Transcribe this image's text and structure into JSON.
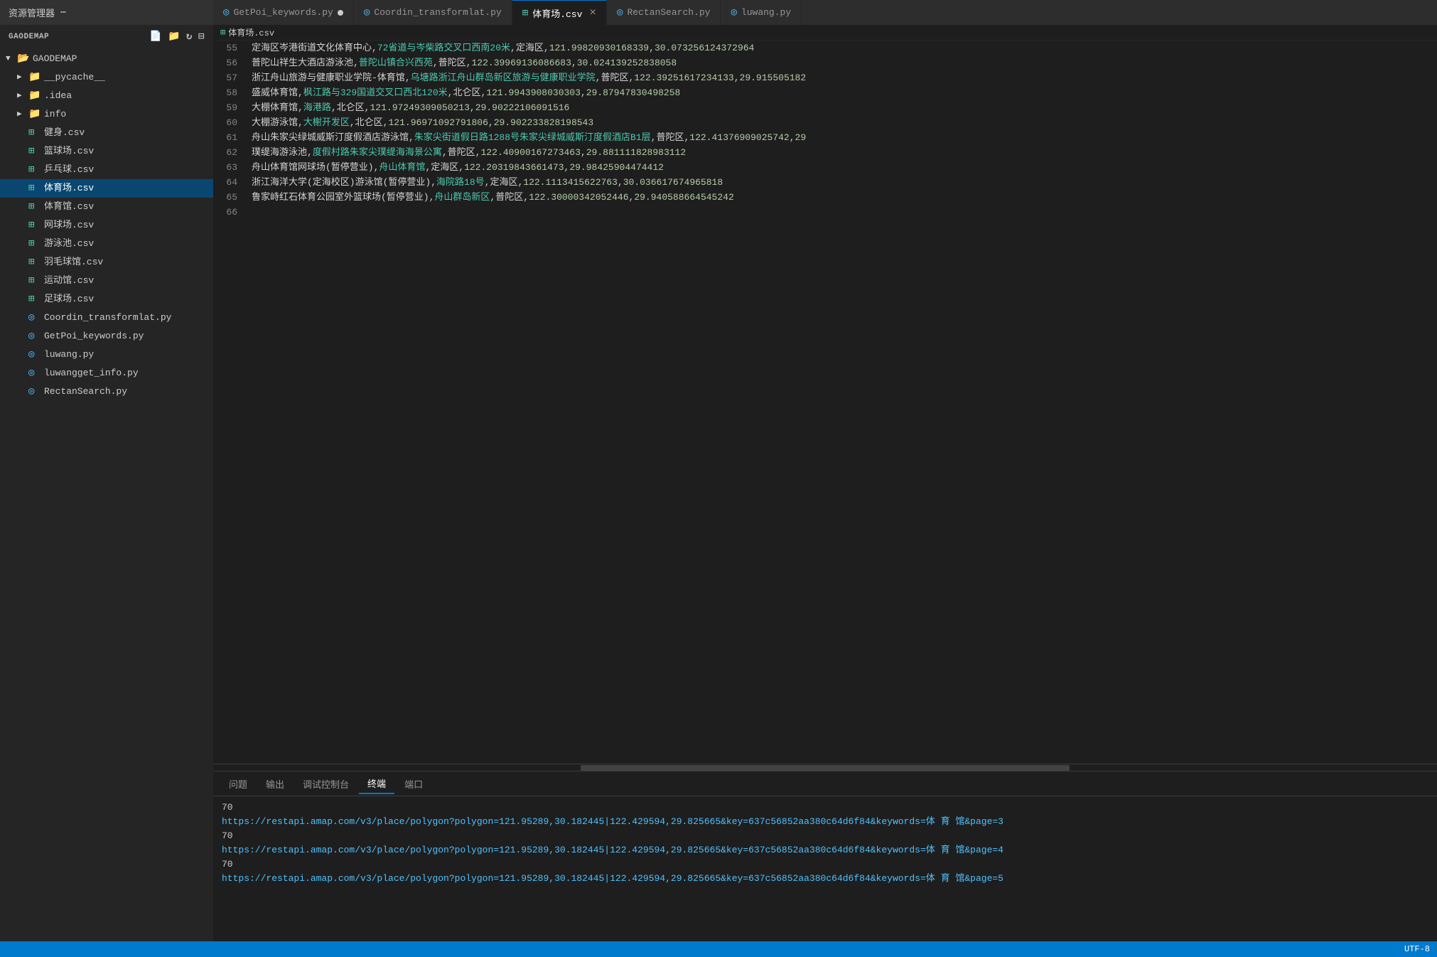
{
  "titlebar": {
    "explorer_label": "资源管理器",
    "more_icon": "⋯"
  },
  "tabs": [
    {
      "id": "tab-getpoi",
      "label": "GetPoi_keywords.py",
      "type": "py",
      "active": false,
      "modified": true,
      "close": false
    },
    {
      "id": "tab-coordin",
      "label": "Coordin_transformlat.py",
      "type": "py",
      "active": false,
      "modified": false,
      "close": false
    },
    {
      "id": "tab-tiyuchang",
      "label": "体育场.csv",
      "type": "csv",
      "active": true,
      "modified": false,
      "close": true
    },
    {
      "id": "tab-rectansearch",
      "label": "RectanSearch.py",
      "type": "py",
      "active": false,
      "modified": false,
      "close": false
    },
    {
      "id": "tab-luwang",
      "label": "luwang.py",
      "type": "py",
      "active": false,
      "modified": false,
      "close": false
    }
  ],
  "sidebar": {
    "title": "资源管理器",
    "root_label": "GAODEMAP",
    "items": [
      {
        "id": "pycache",
        "label": "__pycache__",
        "type": "folder",
        "indent": 1,
        "arrow": "▶"
      },
      {
        "id": "idea",
        "label": ".idea",
        "type": "folder",
        "indent": 1,
        "arrow": "▶"
      },
      {
        "id": "info",
        "label": "info",
        "type": "folder",
        "indent": 1,
        "arrow": "▶"
      },
      {
        "id": "jiansheng",
        "label": "健身.csv",
        "type": "csv",
        "indent": 1
      },
      {
        "id": "lanqiu",
        "label": "篮球场.csv",
        "type": "csv",
        "indent": 1
      },
      {
        "id": "pingpang",
        "label": "乒乓球.csv",
        "type": "csv",
        "indent": 1
      },
      {
        "id": "tiyuchang",
        "label": "体育场.csv",
        "type": "csv",
        "indent": 1,
        "selected": true
      },
      {
        "id": "tiyuguan",
        "label": "体育馆.csv",
        "type": "csv",
        "indent": 1
      },
      {
        "id": "wangqiu",
        "label": "网球场.csv",
        "type": "csv",
        "indent": 1
      },
      {
        "id": "youyongchi",
        "label": "游泳池.csv",
        "type": "csv",
        "indent": 1
      },
      {
        "id": "yumao",
        "label": "羽毛球馆.csv",
        "type": "csv",
        "indent": 1
      },
      {
        "id": "yundongguan",
        "label": "运动馆.csv",
        "type": "csv",
        "indent": 1
      },
      {
        "id": "zuqiu",
        "label": "足球场.csv",
        "type": "csv",
        "indent": 1
      },
      {
        "id": "coordin_py",
        "label": "Coordin_transformlat.py",
        "type": "py",
        "indent": 1
      },
      {
        "id": "getpoi_py",
        "label": "GetPoi_keywords.py",
        "type": "py",
        "indent": 1
      },
      {
        "id": "luwang_py",
        "label": "luwang.py",
        "type": "py",
        "indent": 1
      },
      {
        "id": "luwangget_py",
        "label": "luwangget_info.py",
        "type": "py",
        "indent": 1
      },
      {
        "id": "rectansearch_py",
        "label": "RectanSearch.py",
        "type": "py",
        "indent": 1
      }
    ]
  },
  "breadcrumb": {
    "icon": "⊞",
    "label": "体育场.csv"
  },
  "code_lines": [
    {
      "num": "55",
      "text": "定海区岑港街道文化体育中心,72省道与岑柴路交叉口西南20米,定海区,121.99820930168339,30.073256124372964"
    },
    {
      "num": "56",
      "text": "普陀山祥生大酒店游泳池,普陀山镇合兴西苑,普陀区,122.39969136086683,30.024139252838058"
    },
    {
      "num": "57",
      "text": "浙江舟山旅游与健康职业学院-体育馆,乌塘路浙江舟山群岛新区旅游与健康职业学院,普陀区,122.39251617234133,29.915505182"
    },
    {
      "num": "58",
      "text": "盛威体育馆,枫江路与329国道交叉口西北120米,北仑区,121.9943908030303,29.87947830498258"
    },
    {
      "num": "59",
      "text": "大棚体育馆,海港路,北仑区,121.97249309050213,29.90222106091516"
    },
    {
      "num": "60",
      "text": "大棚游泳馆,大榭开发区,北仑区,121.96971092791806,29.902233828198543"
    },
    {
      "num": "61",
      "text": "舟山朱家尖绿城威斯汀度假酒店游泳馆,朱家尖街道假日路1288号朱家尖绿城威斯汀度假酒店B1层,普陀区,122.41376909025742,29"
    },
    {
      "num": "62",
      "text": "璞缇海游泳池,度假村路朱家尖璞缇海海景公寓,普陀区,122.40900167273463,29.881111828983112"
    },
    {
      "num": "63",
      "text": "舟山体育馆网球场(暂停营业),舟山体育馆,定海区,122.20319843661473,29.98425904474412"
    },
    {
      "num": "64",
      "text": "浙江海洋大学(定海校区)游泳馆(暂停营业),海院路18号,定海区,122.1113415622763,30.036617674965818"
    },
    {
      "num": "65",
      "text": "鲁家峙红石体育公园室外篮球场(暂停营业),舟山群岛新区,普陀区,122.30000342052446,29.940588664545242"
    },
    {
      "num": "66",
      "text": ""
    }
  ],
  "terminal": {
    "tabs": [
      {
        "id": "problems",
        "label": "问题"
      },
      {
        "id": "output",
        "label": "输出"
      },
      {
        "id": "debug",
        "label": "调试控制台"
      },
      {
        "id": "terminal",
        "label": "终端",
        "active": true
      },
      {
        "id": "port",
        "label": "端口"
      }
    ],
    "lines": [
      "70",
      "https://restapi.amap.com/v3/place/polygon?polygon=121.95289,30.182445|122.429594,29.825665&key=637c56852aa380c64d6f84&keywords=体 育 馆&page=3",
      "70",
      "https://restapi.amap.com/v3/place/polygon?polygon=121.95289,30.182445|122.429594,29.825665&key=637c56852aa380c64d6f84&keywords=体 育 馆&page=4",
      "70",
      "https://restapi.amap.com/v3/place/polygon?polygon=121.95289,30.182445|122.429594,29.825665&key=637c56852aa380c64d6f84&keywords=体 育 馆&page=5"
    ]
  },
  "statusbar": {
    "text": "UTF-8"
  },
  "icons": {
    "csv": "⊞",
    "py": "◎",
    "folder_closed": "▶",
    "folder_open": "▼",
    "new_file": "📄",
    "new_folder": "📁",
    "refresh": "↻",
    "collapse": "⊟"
  }
}
